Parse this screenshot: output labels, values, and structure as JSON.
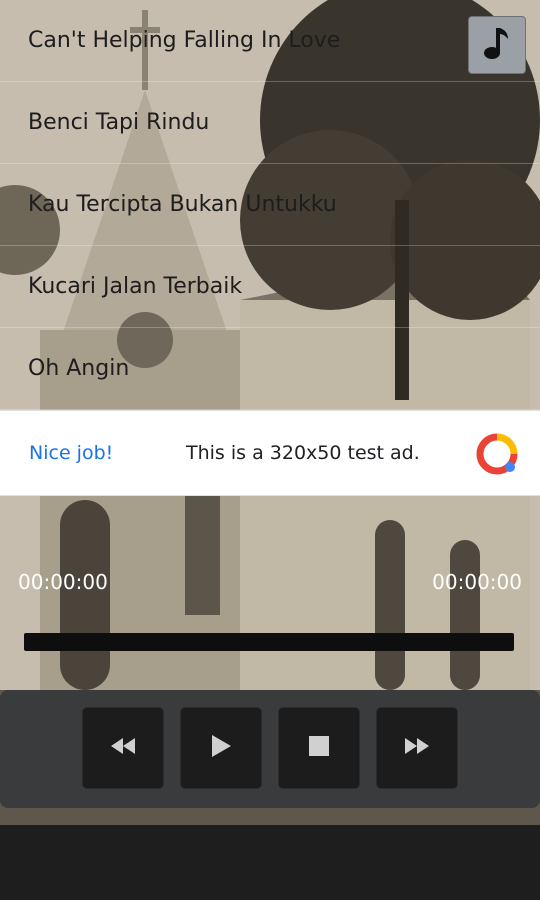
{
  "songs": [
    {
      "title": "Can't Helping Falling In Love"
    },
    {
      "title": "Benci Tapi Rindu"
    },
    {
      "title": "Kau Tercipta Bukan Untukku"
    },
    {
      "title": "Kucari Jalan Terbaik"
    },
    {
      "title": "Oh Angin"
    }
  ],
  "toolbar": {
    "music_icon": "music-note-icon"
  },
  "ad": {
    "title": "Nice job!",
    "text": "This is a 320x50 test ad.",
    "logo_icon": "ad-logo-icon"
  },
  "player": {
    "current_time": "00:00:00",
    "total_time": "00:00:00",
    "progress": 0.0,
    "buttons": [
      {
        "name": "rewind",
        "icon": "rewind-icon"
      },
      {
        "name": "play",
        "icon": "play-icon"
      },
      {
        "name": "stop",
        "icon": "stop-icon"
      },
      {
        "name": "fast-forward",
        "icon": "fast-forward-icon"
      }
    ]
  },
  "colors": {
    "ad_title": "#1a73e8",
    "control_panel": "#3a3b3c",
    "button_bg": "#1c1c1c"
  }
}
